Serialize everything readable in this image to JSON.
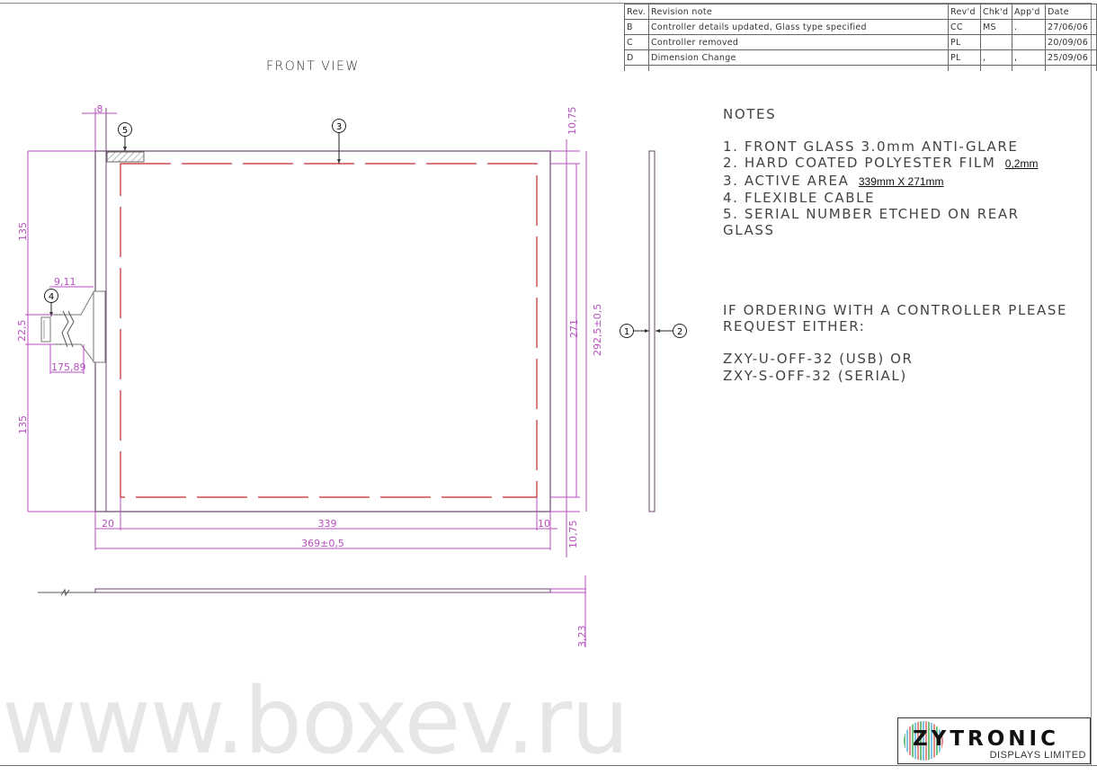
{
  "revision_table": {
    "headers": [
      "Rev.",
      "Revision note",
      "Rev'd",
      "Chk'd",
      "App'd",
      "Date"
    ],
    "rows": [
      {
        "rev": "B",
        "note": "Controller details updated, Glass type specified",
        "revd": "CC",
        "chkd": "MS",
        "appd": ".",
        "date": "27/06/06"
      },
      {
        "rev": "C",
        "note": "Controller removed",
        "revd": "PL",
        "chkd": "",
        "appd": "",
        "date": "20/09/06"
      },
      {
        "rev": "D",
        "note": "Dimension Change",
        "revd": "PL",
        "chkd": ",",
        "appd": ",",
        "date": "25/09/06"
      }
    ]
  },
  "view_title": "FRONT VIEW",
  "notes": {
    "heading": "NOTES",
    "items": [
      {
        "text": "1. FRONT GLASS 3.0mm ANTI-GLARE",
        "value": ""
      },
      {
        "text": "2. HARD COATED POLYESTER FILM",
        "value": "0,2mm"
      },
      {
        "text": "3. ACTIVE AREA",
        "value": "339mm X 271mm"
      },
      {
        "text": "4. FLEXIBLE CABLE",
        "value": ""
      },
      {
        "text": "5. SERIAL NUMBER ETCHED ON REAR",
        "value": ""
      },
      {
        "text": "GLASS",
        "value": ""
      }
    ]
  },
  "ordering": {
    "line1": "IF ORDERING WITH A CONTROLLER PLEASE",
    "line2": "REQUEST EITHER:",
    "option_usb": "ZXY-U-OFF-32 (USB) OR",
    "option_serial": "ZXY-S-OFF-32 (SERIAL)"
  },
  "dimensions": {
    "bezel_left_width": "8",
    "top_margin": "10,75",
    "bottom_margin": "10,75",
    "left_upper": "135",
    "left_lower": "135",
    "cable_width": "22,5",
    "cable_offset": "9,11",
    "cable_length": "175,89",
    "left_border": "20",
    "active_width": "339",
    "right_border": "10",
    "overall_width": "369±0,5",
    "active_height": "271",
    "overall_height": "292,5±0,5",
    "thickness": "3,23"
  },
  "callouts": [
    "1",
    "2",
    "3",
    "4",
    "5"
  ],
  "colors": {
    "dimension": "#b84fc0",
    "active_area": "#c0282c",
    "outline": "#6a4a6e"
  },
  "watermark": "www.boxev.ru",
  "logo": {
    "name": "ZYTRONIC",
    "subtitle": "DISPLAYS LIMITED"
  }
}
